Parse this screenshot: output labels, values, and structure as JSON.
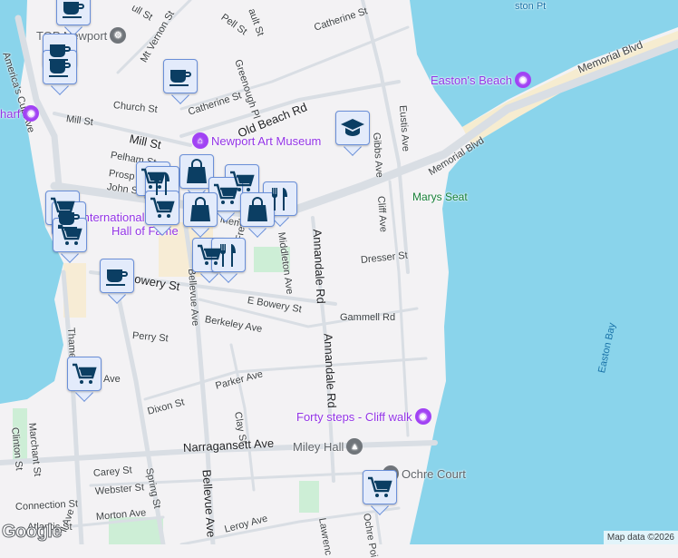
{
  "streets": {
    "americas_cup": "America's Cup Ave",
    "mt_vernon": "Mt Vernon St",
    "pell": "Pell St",
    "catherine1": "Catherine St",
    "greenough": "Greenough Pl",
    "catherine2": "Catherine St",
    "church": "Church St",
    "old_beach": "Old Beach Rd",
    "mill1": "Mill St",
    "mill2": "Mill St",
    "pelham": "Pelham St",
    "prospect": "Prosp",
    "john": "John S",
    "memorial1": "Memorial Blvd",
    "memorial2": "Memorial Blvd",
    "memorial3": "Mem",
    "eustis": "Eustis Ave",
    "gibbs": "Gibbs Ave",
    "cliff": "Cliff Ave",
    "freebody": "Freebody St",
    "middleton": "Middleton Ave",
    "annandale1": "Annandale Rd",
    "annandale2": "Annandale Rd",
    "dresser": "Dresser St",
    "bowery": "Bowery St",
    "e_bowery": "E Bowery St",
    "gammell": "Gammell Rd",
    "berkeley": "Berkeley Ave",
    "bellevue1": "Bellevue Ave",
    "bellevue2": "Bellevue Ave",
    "perry": "Perry St",
    "thames": "Thames",
    "parker": "Parker Ave",
    "ave_frag": "Ave",
    "dixon": "Dixon St",
    "clay": "Clay St",
    "narragansett": "Narragansett Ave",
    "marchant": "Marchant St",
    "clinton": "Clinton St",
    "carey": "Carey St",
    "webster": "Webster St",
    "spring": "Spring St",
    "connection": "Connection St",
    "morton": "Morton Ave",
    "leroy": "Leroy Ave",
    "lawrence": "Lawrenc",
    "ochre_point": "Ochre Poi",
    "atlantic": "Atlantic St",
    "ll_ave": "ll Ave",
    "bull": "ull St",
    "gault": "ault St"
  },
  "places": {
    "top_newport": "TOP Newport",
    "wharf": "harf",
    "art_museum": "Newport Art Museum",
    "eastons_beach": "Easton's Beach",
    "marys_seat": "Marys Seat",
    "hall_of_fame_1": "International",
    "hall_of_fame_2": "Hall of Fame",
    "forty_steps": "Forty steps - Cliff walk",
    "miley_hall": "Miley Hall",
    "ochre_court": "Ochre Court",
    "memorial_blvd_top": "Memorial Blvd",
    "easton_bay": "Easton Bay",
    "easton_pt": "ston Pt"
  },
  "markers": [
    {
      "type": "coffee"
    },
    {
      "type": "coffee"
    },
    {
      "type": "coffee"
    },
    {
      "type": "coffee"
    },
    {
      "type": "school"
    },
    {
      "type": "cart"
    },
    {
      "type": "restaurant"
    },
    {
      "type": "bag"
    },
    {
      "type": "cart"
    },
    {
      "type": "restaurant"
    },
    {
      "type": "cart"
    },
    {
      "type": "bag"
    },
    {
      "type": "cart"
    },
    {
      "type": "bag"
    },
    {
      "type": "cart"
    },
    {
      "type": "restaurant"
    },
    {
      "type": "cart"
    },
    {
      "type": "coffee"
    },
    {
      "type": "cart"
    },
    {
      "type": "coffee"
    },
    {
      "type": "cart"
    },
    {
      "type": "cart"
    }
  ],
  "footer": {
    "logo": "Google",
    "attribution": "Map data ©2026"
  },
  "colors": {
    "water": "#8ad4eb",
    "land": "#f3f2f4",
    "road": "#d9dee4",
    "marker_bg": "#e3ebfb",
    "marker_border": "#6a8fd8",
    "icon": "#0b3e63",
    "poi": "#9334e6"
  }
}
